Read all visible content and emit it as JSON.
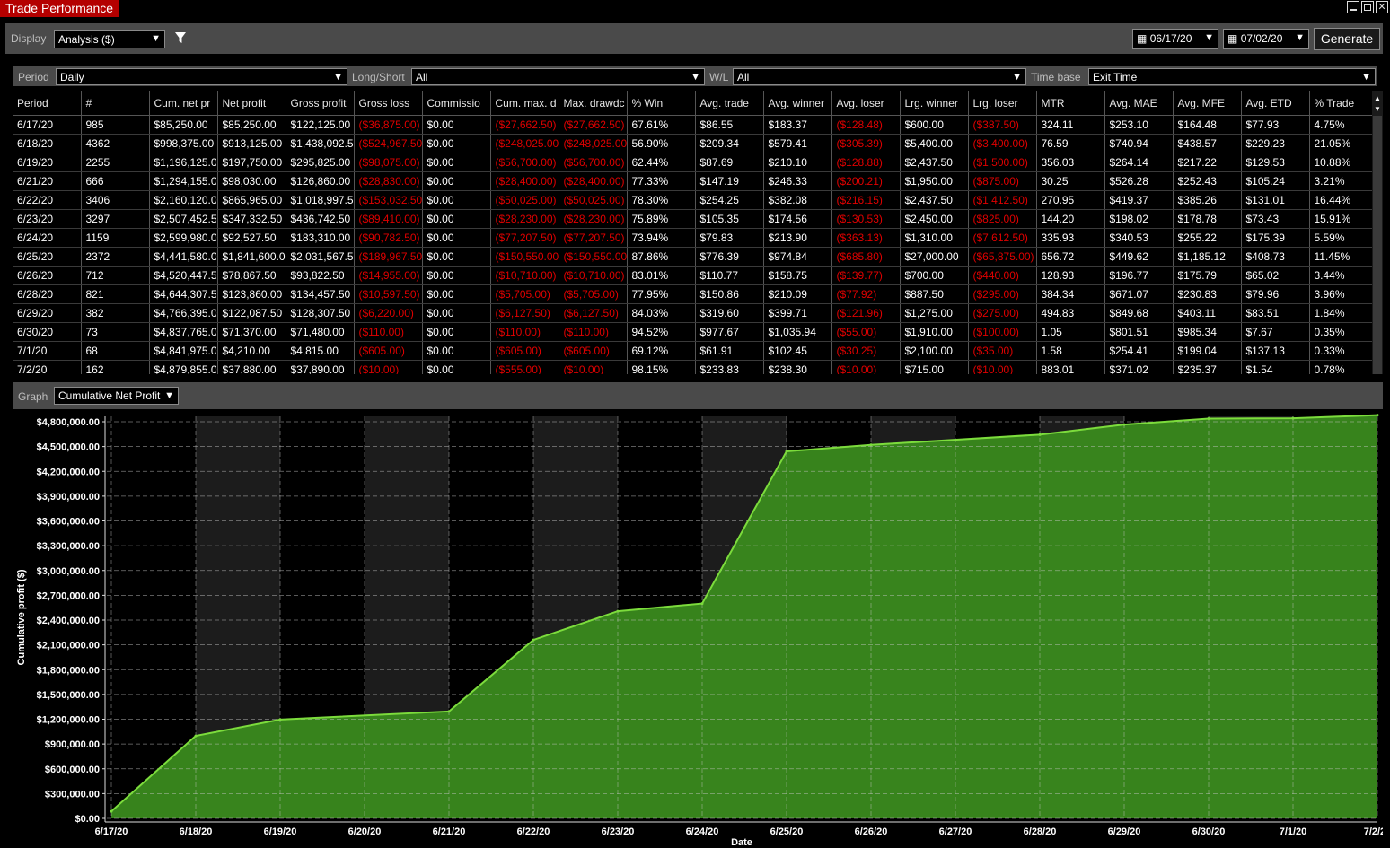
{
  "window": {
    "title": "Trade Performance"
  },
  "toolbar": {
    "display_label": "Display",
    "display_value": "Analysis ($)",
    "date_from": "06/17/20",
    "date_to": "07/02/20",
    "generate_label": "Generate",
    "icons": {
      "filter": "filter-icon",
      "calendar": "calendar-icon"
    }
  },
  "filters": {
    "period_label": "Period",
    "period_value": "Daily",
    "longshort_label": "Long/Short",
    "longshort_value": "All",
    "wl_label": "W/L",
    "wl_value": "All",
    "timebase_label": "Time base",
    "timebase_value": "Exit Time"
  },
  "grid": {
    "columns": [
      "Period",
      "#",
      "Cum. net pr",
      "Net profit",
      "Gross profit",
      "Gross loss",
      "Commissio",
      "Cum. max. d",
      "Max. drawdc",
      "% Win",
      "Avg. trade",
      "Avg. winner",
      "Avg. loser",
      "Lrg. winner",
      "Lrg. loser",
      "MTR",
      "Avg. MAE",
      "Avg. MFE",
      "Avg. ETD",
      "% Trade"
    ],
    "rows": [
      [
        "6/17/20",
        "985",
        "$85,250.00",
        "$85,250.00",
        "$122,125.00",
        "($36,875.00)",
        "$0.00",
        "($27,662.50)",
        "($27,662.50)",
        "67.61%",
        "$86.55",
        "$183.37",
        "($128.48)",
        "$600.00",
        "($387.50)",
        "324.11",
        "$253.10",
        "$164.48",
        "$77.93",
        "4.75%"
      ],
      [
        "6/18/20",
        "4362",
        "$998,375.00",
        "$913,125.00",
        "$1,438,092.50",
        "($524,967.50)",
        "$0.00",
        "($248,025.00)",
        "($248,025.00)",
        "56.90%",
        "$209.34",
        "$579.41",
        "($305.39)",
        "$5,400.00",
        "($3,400.00)",
        "76.59",
        "$740.94",
        "$438.57",
        "$229.23",
        "21.05%"
      ],
      [
        "6/19/20",
        "2255",
        "$1,196,125.00",
        "$197,750.00",
        "$295,825.00",
        "($98,075.00)",
        "$0.00",
        "($56,700.00)",
        "($56,700.00)",
        "62.44%",
        "$87.69",
        "$210.10",
        "($128.88)",
        "$2,437.50",
        "($1,500.00)",
        "356.03",
        "$264.14",
        "$217.22",
        "$129.53",
        "10.88%"
      ],
      [
        "6/21/20",
        "666",
        "$1,294,155.00",
        "$98,030.00",
        "$126,860.00",
        "($28,830.00)",
        "$0.00",
        "($28,400.00)",
        "($28,400.00)",
        "77.33%",
        "$147.19",
        "$246.33",
        "($200.21)",
        "$1,950.00",
        "($875.00)",
        "30.25",
        "$526.28",
        "$252.43",
        "$105.24",
        "3.21%"
      ],
      [
        "6/22/20",
        "3406",
        "$2,160,120.00",
        "$865,965.00",
        "$1,018,997.50",
        "($153,032.50)",
        "$0.00",
        "($50,025.00)",
        "($50,025.00)",
        "78.30%",
        "$254.25",
        "$382.08",
        "($216.15)",
        "$2,437.50",
        "($1,412.50)",
        "270.95",
        "$419.37",
        "$385.26",
        "$131.01",
        "16.44%"
      ],
      [
        "6/23/20",
        "3297",
        "$2,507,452.50",
        "$347,332.50",
        "$436,742.50",
        "($89,410.00)",
        "$0.00",
        "($28,230.00)",
        "($28,230.00)",
        "75.89%",
        "$105.35",
        "$174.56",
        "($130.53)",
        "$2,450.00",
        "($825.00)",
        "144.20",
        "$198.02",
        "$178.78",
        "$73.43",
        "15.91%"
      ],
      [
        "6/24/20",
        "1159",
        "$2,599,980.00",
        "$92,527.50",
        "$183,310.00",
        "($90,782.50)",
        "$0.00",
        "($77,207.50)",
        "($77,207.50)",
        "73.94%",
        "$79.83",
        "$213.90",
        "($363.13)",
        "$1,310.00",
        "($7,612.50)",
        "335.93",
        "$340.53",
        "$255.22",
        "$175.39",
        "5.59%"
      ],
      [
        "6/25/20",
        "2372",
        "$4,441,580.00",
        "$1,841,600.00",
        "$2,031,567.50",
        "($189,967.50)",
        "$0.00",
        "($150,550.00)",
        "($150,550.00)",
        "87.86%",
        "$776.39",
        "$974.84",
        "($685.80)",
        "$27,000.00",
        "($65,875.00)",
        "656.72",
        "$449.62",
        "$1,185.12",
        "$408.73",
        "11.45%"
      ],
      [
        "6/26/20",
        "712",
        "$4,520,447.50",
        "$78,867.50",
        "$93,822.50",
        "($14,955.00)",
        "$0.00",
        "($10,710.00)",
        "($10,710.00)",
        "83.01%",
        "$110.77",
        "$158.75",
        "($139.77)",
        "$700.00",
        "($440.00)",
        "128.93",
        "$196.77",
        "$175.79",
        "$65.02",
        "3.44%"
      ],
      [
        "6/28/20",
        "821",
        "$4,644,307.50",
        "$123,860.00",
        "$134,457.50",
        "($10,597.50)",
        "$0.00",
        "($5,705.00)",
        "($5,705.00)",
        "77.95%",
        "$150.86",
        "$210.09",
        "($77.92)",
        "$887.50",
        "($295.00)",
        "384.34",
        "$671.07",
        "$230.83",
        "$79.96",
        "3.96%"
      ],
      [
        "6/29/20",
        "382",
        "$4,766,395.00",
        "$122,087.50",
        "$128,307.50",
        "($6,220.00)",
        "$0.00",
        "($6,127.50)",
        "($6,127.50)",
        "84.03%",
        "$319.60",
        "$399.71",
        "($121.96)",
        "$1,275.00",
        "($275.00)",
        "494.83",
        "$849.68",
        "$403.11",
        "$83.51",
        "1.84%"
      ],
      [
        "6/30/20",
        "73",
        "$4,837,765.00",
        "$71,370.00",
        "$71,480.00",
        "($110.00)",
        "$0.00",
        "($110.00)",
        "($110.00)",
        "94.52%",
        "$977.67",
        "$1,035.94",
        "($55.00)",
        "$1,910.00",
        "($100.00)",
        "1.05",
        "$801.51",
        "$985.34",
        "$7.67",
        "0.35%"
      ],
      [
        "7/1/20",
        "68",
        "$4,841,975.00",
        "$4,210.00",
        "$4,815.00",
        "($605.00)",
        "$0.00",
        "($605.00)",
        "($605.00)",
        "69.12%",
        "$61.91",
        "$102.45",
        "($30.25)",
        "$2,100.00",
        "($35.00)",
        "1.58",
        "$254.41",
        "$199.04",
        "$137.13",
        "0.33%"
      ],
      [
        "7/2/20",
        "162",
        "$4,879,855.00",
        "$37,880.00",
        "$37,890.00",
        "($10.00)",
        "$0.00",
        "($555.00)",
        "($10.00)",
        "98.15%",
        "$233.83",
        "$238.30",
        "($10.00)",
        "$715.00",
        "($10.00)",
        "883.01",
        "$371.02",
        "$235.37",
        "$1.54",
        "0.78%"
      ]
    ]
  },
  "graph": {
    "label": "Graph",
    "selected": "Cumulative Net Profit"
  },
  "chart_data": {
    "type": "area",
    "ylabel": "Cumulative profit ($)",
    "xlabel": "Date",
    "ylim": [
      0,
      4800000
    ],
    "yticks": [
      "$0.00",
      "$300,000.00",
      "$600,000.00",
      "$900,000.00",
      "$1,200,000.00",
      "$1,500,000.00",
      "$1,800,000.00",
      "$2,100,000.00",
      "$2,400,000.00",
      "$2,700,000.00",
      "$3,000,000.00",
      "$3,300,000.00",
      "$3,600,000.00",
      "$3,900,000.00",
      "$4,200,000.00",
      "$4,500,000.00",
      "$4,800,000.00"
    ],
    "ytick_values": [
      0,
      300000,
      600000,
      900000,
      1200000,
      1500000,
      1800000,
      2100000,
      2400000,
      2700000,
      3000000,
      3300000,
      3600000,
      3900000,
      4200000,
      4500000,
      4800000
    ],
    "x_labels": [
      "6/17/20",
      "6/18/20",
      "6/19/20",
      "6/20/20",
      "6/21/20",
      "6/22/20",
      "6/23/20",
      "6/24/20",
      "6/25/20",
      "6/26/20",
      "6/27/20",
      "6/28/20",
      "6/29/20",
      "6/30/20",
      "7/1/20",
      "7/2/20"
    ],
    "x": [
      "6/17/20",
      "6/18/20",
      "6/19/20",
      "6/21/20",
      "6/22/20",
      "6/23/20",
      "6/24/20",
      "6/25/20",
      "6/26/20",
      "6/28/20",
      "6/29/20",
      "6/30/20",
      "7/1/20",
      "7/2/20"
    ],
    "values": [
      85250,
      998375,
      1196125,
      1294155,
      2160120,
      2507452.5,
      2599980,
      4441580,
      4520447.5,
      4644307.5,
      4766395,
      4837765,
      4841975,
      4879855
    ],
    "grid": true,
    "colors": {
      "fill": "#3a8a1e",
      "line": "#7cdc3c",
      "band_dark": "#000000",
      "band_light": "#1c1c1c"
    }
  }
}
